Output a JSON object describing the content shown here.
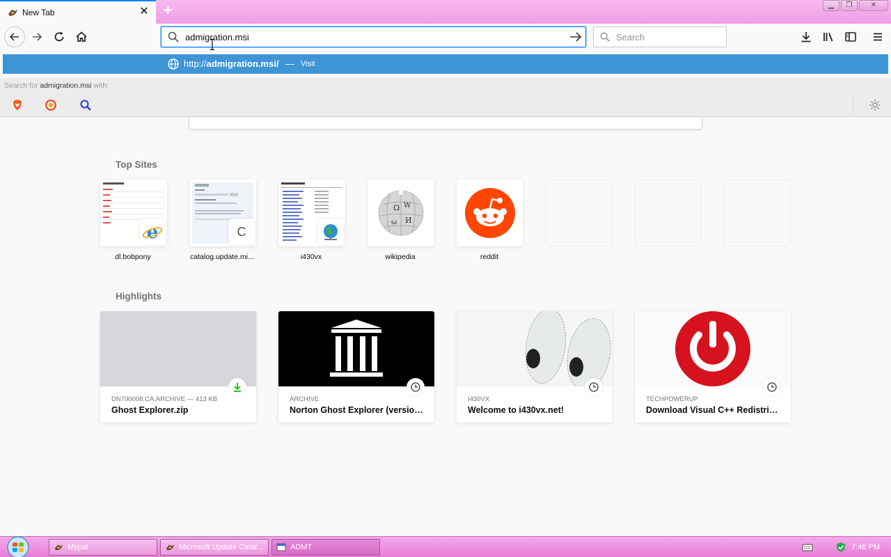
{
  "browser": {
    "tab": {
      "title": "New Tab",
      "close_glyph": "✕"
    },
    "new_tab_glyph": "+",
    "window_controls": {
      "minimize": "▁",
      "maximize": "❐",
      "close": "✕"
    },
    "url": "admigration.msi",
    "search_placeholder": "Search"
  },
  "autocomplete": {
    "url_prefix": "http://",
    "url_host": "admigration.msi/",
    "separator": "—",
    "action": "Visit",
    "search_for_prefix": "Search for",
    "search_for_query": "admigration.msi",
    "search_for_suffix": "with:"
  },
  "top_sites": {
    "title": "Top Sites",
    "items": [
      {
        "label": "dl.bobpony"
      },
      {
        "label": "catalog.update.mi..."
      },
      {
        "label": "i430vx"
      },
      {
        "label": "wikipedia"
      },
      {
        "label": "reddit"
      }
    ],
    "catalog_badge_glyph": "C"
  },
  "highlights": {
    "title": "Highlights",
    "items": [
      {
        "context": "DN790008.CA.ARCHIVE — 413 KB",
        "title": "Ghost Explorer.zip",
        "badge": "download-icon"
      },
      {
        "context": "ARCHIVE",
        "title": "Norton Ghost Explorer (version ...",
        "badge": "clock-icon"
      },
      {
        "context": "I430VX",
        "title": "Welcome to i430vx.net!",
        "badge": "clock-icon"
      },
      {
        "context": "TECHPOWERUP",
        "title": "Download Visual C++ Redistribu...",
        "badge": "clock-icon"
      }
    ]
  },
  "taskbar": {
    "items": [
      {
        "label": "Mypal"
      },
      {
        "label": "Microsoft Update Catal..."
      },
      {
        "label": "ADMT"
      }
    ],
    "clock": "7:46 PM"
  },
  "colors": {
    "accent": "#0a84ff",
    "autocomplete_selected": "#3e95d6",
    "taskbar": "#ef9ee5"
  }
}
